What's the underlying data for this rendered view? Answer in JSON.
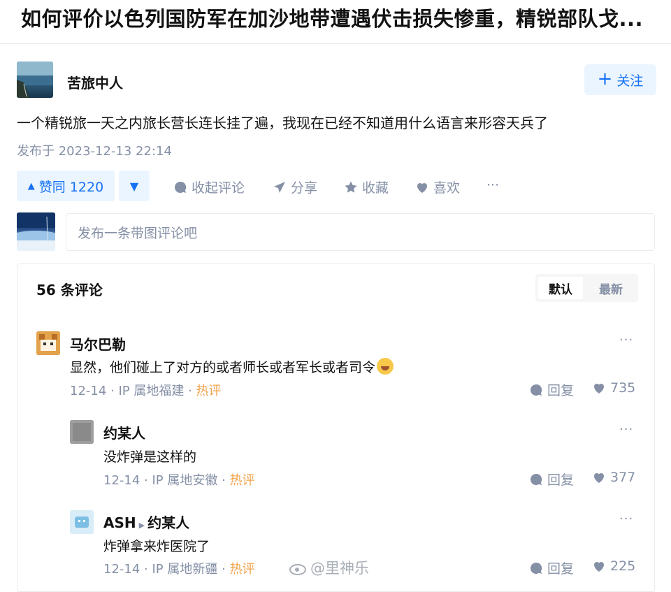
{
  "question_title": "如何评价以色列国防军在加沙地带遭遇伏击损失惨重，精锐部队戈...",
  "answer": {
    "author": "苦旅中人",
    "follow_label": "关注",
    "content": "一个精锐旅一天之内旅长营长连长挂了遍，我现在已经不知道用什么语言来形容天兵了",
    "published": "发布于 2023-12-13 22:14"
  },
  "actions": {
    "upvote": "赞同 1220",
    "collapse_comments": "收起评论",
    "share": "分享",
    "collect": "收藏",
    "like": "喜欢",
    "more": "···"
  },
  "comment_input": {
    "placeholder": "发布一条带图评论吧"
  },
  "comments_header": {
    "count": "56 条评论",
    "sort_default": "默认",
    "sort_newest": "最新"
  },
  "comments": [
    {
      "author": "马尔巴勒",
      "text": "显然，他们碰上了对方的或者师长或者军长或者司令",
      "date": "12-14",
      "location": "IP 属地福建",
      "tag": "热评",
      "reply_label": "回复",
      "likes": "735"
    },
    {
      "author": "约某人",
      "text": "没炸弹是这样的",
      "date": "12-14",
      "location": "IP 属地安徽",
      "tag": "热评",
      "reply_label": "回复",
      "likes": "377"
    },
    {
      "author": "ASH",
      "reply_to": "约某人",
      "text": "炸弹拿来炸医院了",
      "date": "12-14",
      "location": "IP 属地新疆",
      "tag": "热评",
      "reply_label": "回复",
      "likes": "225"
    }
  ],
  "watermark": "@里神乐",
  "colors": {
    "accent": "#1772f6",
    "muted": "#8590a6",
    "hot": "#f0a24a"
  }
}
